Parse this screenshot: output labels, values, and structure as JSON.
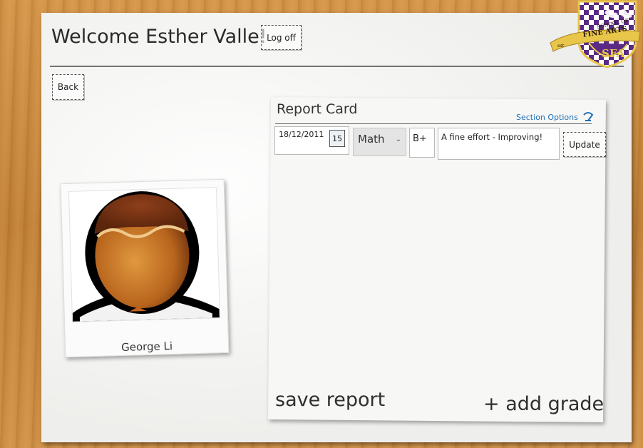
{
  "header": {
    "welcome": "Welcome Esther Valle!",
    "logoff_label": "Log off",
    "back_label": "Back"
  },
  "logo": {
    "line1": "SCHOOL OF",
    "line2": "FINE ARTS",
    "monogram": "SFA",
    "est": "est",
    "colors": {
      "shield": "#5b2a86",
      "ribbon": "#e8c64a",
      "check": "#ffffff"
    }
  },
  "student": {
    "name": "George Li",
    "avatar_icon": "person-avatar-icon"
  },
  "report_card": {
    "title": "Report Card",
    "section_options": "Section Options",
    "entry": {
      "date": "18/12/2011",
      "calendar_day": "15",
      "subject": "Math",
      "grade": "B+",
      "comment": "A fine effort - Improving!"
    },
    "update_label": "Update",
    "save_label": "save report",
    "add_label": "+ add grade"
  }
}
